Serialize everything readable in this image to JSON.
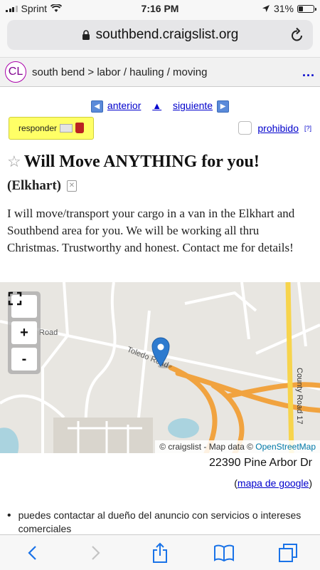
{
  "status_bar": {
    "carrier": "Sprint",
    "time": "7:16 PM",
    "battery": "31%",
    "battery_level": 0.31
  },
  "browser": {
    "url": "southbend.craigslist.org"
  },
  "header": {
    "logo": "CL",
    "breadcrumb": "south bend > labor / hauling / moving",
    "menu": "..."
  },
  "nav": {
    "prev": "anterior",
    "up": "▲",
    "next": "siguiente"
  },
  "actions": {
    "reply": "responder",
    "flag": "prohibido",
    "flag_help": "[?]"
  },
  "post": {
    "title": "Will Move ANYTHING for you!",
    "location": "(Elkhart)",
    "body": "I will move/transport your cargo in a van in the Elkhart and Southbend area for you. We will be working all thru Christmas. Trustworthy and honest. Contact me for details!"
  },
  "map": {
    "labels": {
      "road1": "Road",
      "road2": "Toledo Road",
      "road3": "County Road 17"
    },
    "credit_prefix": "© craigslist - Map data ©",
    "credit_link": "OpenStreetMap",
    "zoom_in": "+",
    "zoom_out": "-"
  },
  "address": "22390 Pine Arbor Dr",
  "google_link": "mapa de google",
  "notice": "puedes contactar al dueño del anuncio con servicios o intereses comerciales",
  "colors": {
    "link": "#0000cc",
    "reply_bg": "#ffff66",
    "road_major": "#f1a33f",
    "road_yellow": "#f7d44c"
  }
}
